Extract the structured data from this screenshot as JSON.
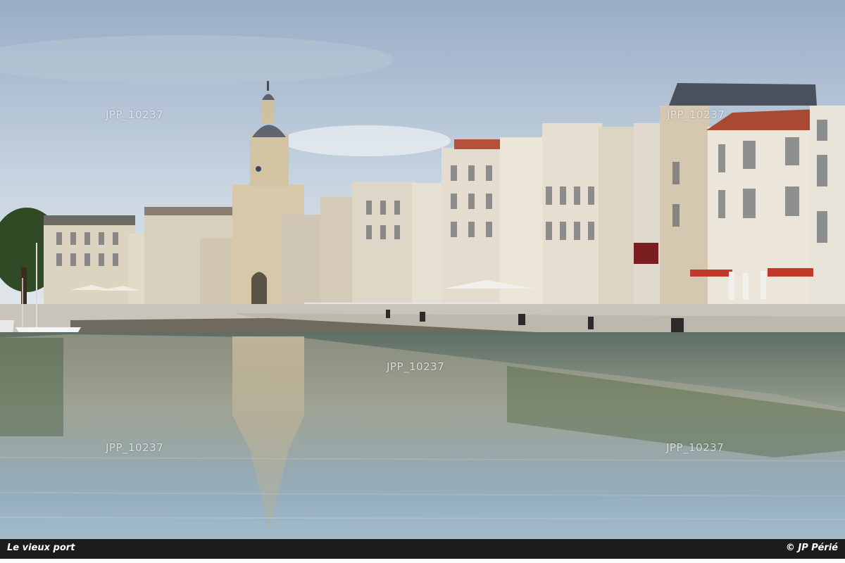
{
  "photo": {
    "subject": "La Rochelle old harbour quay with clock tower and reflections",
    "colors": {
      "sky_top": "#9fb4cc",
      "sky_bottom": "#dfe6ee",
      "water_top": "#6f7c74",
      "water_bottom": "#9ab4c4",
      "stone": "#d8cdb8",
      "awning": "#c0392b"
    }
  },
  "watermarks": [
    "JPP_10237",
    "JPP_10237",
    "JPP_10237",
    "JPP_10237",
    "JPP_10237"
  ],
  "caption": {
    "title": "Le vieux port",
    "credit": "© JP Périé"
  }
}
